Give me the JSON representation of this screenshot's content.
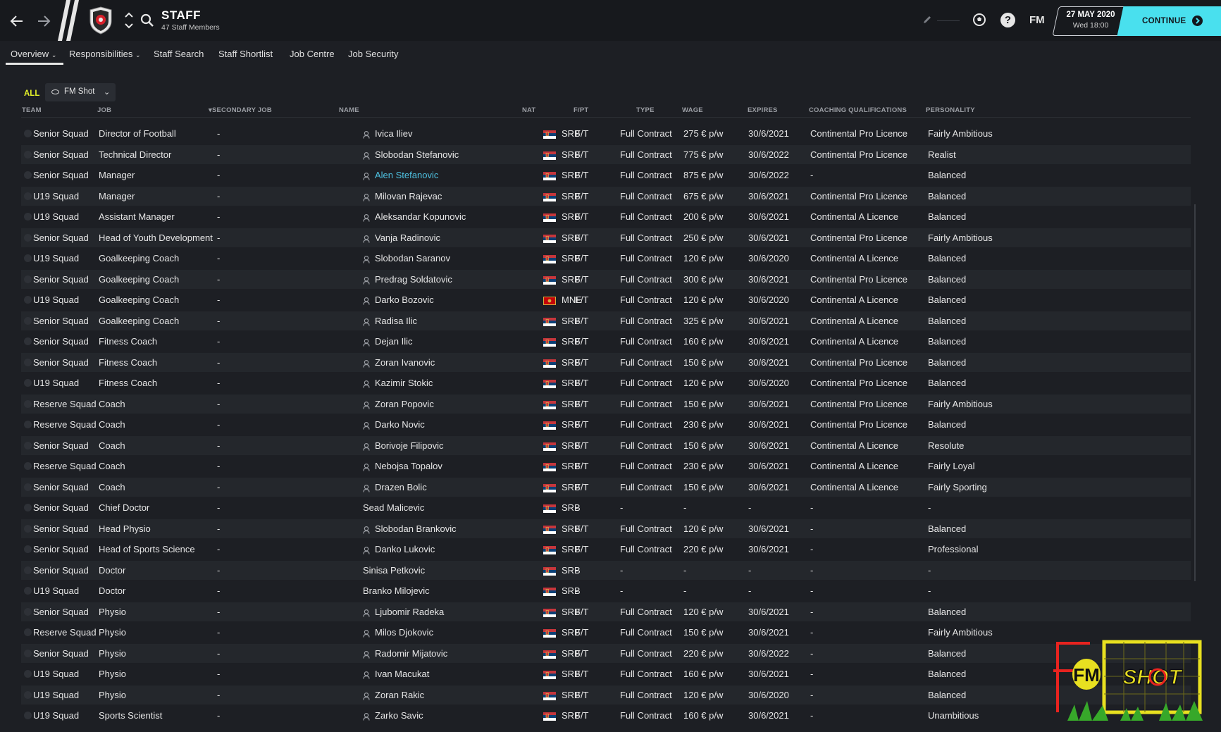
{
  "header": {
    "title": "STAFF",
    "subtitle": "47 Staff Members",
    "date": "27 MAY 2020",
    "time": "Wed 18:00",
    "continue_label": "CONTINUE",
    "fm_label": "FM",
    "help_label": "?"
  },
  "tabs": [
    "Overview",
    "Responsibilities",
    "Staff Search",
    "Staff Shortlist",
    "Job Centre",
    "Job Security"
  ],
  "filter": {
    "all_label": "ALL",
    "view_label": "FM Shot"
  },
  "columns": {
    "team": "TEAM",
    "job": "JOB",
    "secondary": "SECONDARY JOB",
    "name": "NAME",
    "nat": "NAT",
    "fpt": "F/PT",
    "type": "TYPE",
    "wage": "WAGE",
    "expires": "EXPIRES",
    "coaching": "COACHING QUALIFICATIONS",
    "personality": "PERSONALITY"
  },
  "rows": [
    {
      "team": "Senior Squad",
      "job": "Director of Football",
      "secondary": "-",
      "name": "Ivica Iliev",
      "nat": "SRB",
      "fpt": "F/T",
      "type": "Full Contract",
      "wage": "275 € p/w",
      "expires": "30/6/2021",
      "coaching": "Continental Pro Licence",
      "personality": "Fairly Ambitious",
      "person": true
    },
    {
      "team": "Senior Squad",
      "job": "Technical Director",
      "secondary": "-",
      "name": "Slobodan Stefanovic",
      "nat": "SRB",
      "fpt": "F/T",
      "type": "Full Contract",
      "wage": "775 € p/w",
      "expires": "30/6/2022",
      "coaching": "Continental Pro Licence",
      "personality": "Realist",
      "person": true
    },
    {
      "team": "Senior Squad",
      "job": "Manager",
      "secondary": "-",
      "name": "Alen Stefanovic",
      "nat": "SRB",
      "fpt": "F/T",
      "type": "Full Contract",
      "wage": "875 € p/w",
      "expires": "30/6/2022",
      "coaching": "-",
      "personality": "Balanced",
      "person": true,
      "highlight": true
    },
    {
      "team": "U19 Squad",
      "job": "Manager",
      "secondary": "-",
      "name": "Milovan Rajevac",
      "nat": "SRB",
      "fpt": "F/T",
      "type": "Full Contract",
      "wage": "675 € p/w",
      "expires": "30/6/2021",
      "coaching": "Continental Pro Licence",
      "personality": "Balanced",
      "person": true
    },
    {
      "team": "U19 Squad",
      "job": "Assistant Manager",
      "secondary": "-",
      "name": "Aleksandar Kopunovic",
      "nat": "SRB",
      "fpt": "F/T",
      "type": "Full Contract",
      "wage": "200 € p/w",
      "expires": "30/6/2021",
      "coaching": "Continental A Licence",
      "personality": "Balanced",
      "person": true
    },
    {
      "team": "Senior Squad",
      "job": "Head of Youth Development",
      "secondary": "-",
      "name": "Vanja Radinovic",
      "nat": "SRB",
      "fpt": "F/T",
      "type": "Full Contract",
      "wage": "250 € p/w",
      "expires": "30/6/2021",
      "coaching": "Continental Pro Licence",
      "personality": "Fairly Ambitious",
      "person": true
    },
    {
      "team": "U19 Squad",
      "job": "Goalkeeping Coach",
      "secondary": "-",
      "name": "Slobodan Saranov",
      "nat": "SRB",
      "fpt": "F/T",
      "type": "Full Contract",
      "wage": "120 € p/w",
      "expires": "30/6/2020",
      "coaching": "Continental A Licence",
      "personality": "Balanced",
      "person": true
    },
    {
      "team": "Senior Squad",
      "job": "Goalkeeping Coach",
      "secondary": "-",
      "name": "Predrag Soldatovic",
      "nat": "SRB",
      "fpt": "F/T",
      "type": "Full Contract",
      "wage": "300 € p/w",
      "expires": "30/6/2021",
      "coaching": "Continental Pro Licence",
      "personality": "Balanced",
      "person": true
    },
    {
      "team": "U19 Squad",
      "job": "Goalkeeping Coach",
      "secondary": "-",
      "name": "Darko Bozovic",
      "nat": "MNE",
      "fpt": "F/T",
      "type": "Full Contract",
      "wage": "120 € p/w",
      "expires": "30/6/2020",
      "coaching": "Continental A Licence",
      "personality": "Balanced",
      "person": true
    },
    {
      "team": "Senior Squad",
      "job": "Goalkeeping Coach",
      "secondary": "-",
      "name": "Radisa Ilic",
      "nat": "SRB",
      "fpt": "F/T",
      "type": "Full Contract",
      "wage": "325 € p/w",
      "expires": "30/6/2021",
      "coaching": "Continental A Licence",
      "personality": "Balanced",
      "person": true
    },
    {
      "team": "Senior Squad",
      "job": "Fitness Coach",
      "secondary": "-",
      "name": "Dejan Ilic",
      "nat": "SRB",
      "fpt": "F/T",
      "type": "Full Contract",
      "wage": "160 € p/w",
      "expires": "30/6/2021",
      "coaching": "Continental A Licence",
      "personality": "Balanced",
      "person": true
    },
    {
      "team": "Senior Squad",
      "job": "Fitness Coach",
      "secondary": "-",
      "name": "Zoran Ivanovic",
      "nat": "SRB",
      "fpt": "F/T",
      "type": "Full Contract",
      "wage": "150 € p/w",
      "expires": "30/6/2021",
      "coaching": "Continental Pro Licence",
      "personality": "Balanced",
      "person": true
    },
    {
      "team": "U19 Squad",
      "job": "Fitness Coach",
      "secondary": "-",
      "name": "Kazimir Stokic",
      "nat": "SRB",
      "fpt": "F/T",
      "type": "Full Contract",
      "wage": "120 € p/w",
      "expires": "30/6/2020",
      "coaching": "Continental Pro Licence",
      "personality": "Balanced",
      "person": true
    },
    {
      "team": "Reserve Squad",
      "job": "Coach",
      "secondary": "-",
      "name": "Zoran Popovic",
      "nat": "SRB",
      "fpt": "F/T",
      "type": "Full Contract",
      "wage": "150 € p/w",
      "expires": "30/6/2021",
      "coaching": "Continental Pro Licence",
      "personality": "Fairly Ambitious",
      "person": true
    },
    {
      "team": "Reserve Squad",
      "job": "Coach",
      "secondary": "-",
      "name": "Darko Novic",
      "nat": "SRB",
      "fpt": "F/T",
      "type": "Full Contract",
      "wage": "230 € p/w",
      "expires": "30/6/2021",
      "coaching": "Continental Pro Licence",
      "personality": "Balanced",
      "person": true
    },
    {
      "team": "Senior Squad",
      "job": "Coach",
      "secondary": "-",
      "name": "Borivoje Filipovic",
      "nat": "SRB",
      "fpt": "F/T",
      "type": "Full Contract",
      "wage": "150 € p/w",
      "expires": "30/6/2021",
      "coaching": "Continental A Licence",
      "personality": "Resolute",
      "person": true
    },
    {
      "team": "Reserve Squad",
      "job": "Coach",
      "secondary": "-",
      "name": "Nebojsa Topalov",
      "nat": "SRB",
      "fpt": "F/T",
      "type": "Full Contract",
      "wage": "230 € p/w",
      "expires": "30/6/2021",
      "coaching": "Continental A Licence",
      "personality": "Fairly Loyal",
      "person": true
    },
    {
      "team": "Senior Squad",
      "job": "Coach",
      "secondary": "-",
      "name": "Drazen Bolic",
      "nat": "SRB",
      "fpt": "F/T",
      "type": "Full Contract",
      "wage": "150 € p/w",
      "expires": "30/6/2021",
      "coaching": "Continental A Licence",
      "personality": "Fairly Sporting",
      "person": true
    },
    {
      "team": "Senior Squad",
      "job": "Chief Doctor",
      "secondary": "-",
      "name": "Sead Malicevic",
      "nat": "SRB",
      "fpt": "-",
      "type": "-",
      "wage": "-",
      "expires": "-",
      "coaching": "-",
      "personality": "-",
      "person": false
    },
    {
      "team": "Senior Squad",
      "job": "Head Physio",
      "secondary": "-",
      "name": "Slobodan Brankovic",
      "nat": "SRB",
      "fpt": "F/T",
      "type": "Full Contract",
      "wage": "120 € p/w",
      "expires": "30/6/2021",
      "coaching": "-",
      "personality": "Balanced",
      "person": true
    },
    {
      "team": "Senior Squad",
      "job": "Head of Sports Science",
      "secondary": "-",
      "name": "Danko Lukovic",
      "nat": "SRB",
      "fpt": "F/T",
      "type": "Full Contract",
      "wage": "220 € p/w",
      "expires": "30/6/2021",
      "coaching": "-",
      "personality": "Professional",
      "person": true
    },
    {
      "team": "Senior Squad",
      "job": "Doctor",
      "secondary": "-",
      "name": "Sinisa Petkovic",
      "nat": "SRB",
      "fpt": "-",
      "type": "-",
      "wage": "-",
      "expires": "-",
      "coaching": "-",
      "personality": "-",
      "person": false
    },
    {
      "team": "U19 Squad",
      "job": "Doctor",
      "secondary": "-",
      "name": "Branko Milojevic",
      "nat": "SRB",
      "fpt": "-",
      "type": "-",
      "wage": "-",
      "expires": "-",
      "coaching": "-",
      "personality": "-",
      "person": false
    },
    {
      "team": "Senior Squad",
      "job": "Physio",
      "secondary": "-",
      "name": "Ljubomir Radeka",
      "nat": "SRB",
      "fpt": "F/T",
      "type": "Full Contract",
      "wage": "120 € p/w",
      "expires": "30/6/2021",
      "coaching": "-",
      "personality": "Balanced",
      "person": true
    },
    {
      "team": "Reserve Squad",
      "job": "Physio",
      "secondary": "-",
      "name": "Milos Djokovic",
      "nat": "SRB",
      "fpt": "F/T",
      "type": "Full Contract",
      "wage": "150 € p/w",
      "expires": "30/6/2021",
      "coaching": "-",
      "personality": "Fairly Ambitious",
      "person": true
    },
    {
      "team": "Senior Squad",
      "job": "Physio",
      "secondary": "-",
      "name": "Radomir Mijatovic",
      "nat": "SRB",
      "fpt": "F/T",
      "type": "Full Contract",
      "wage": "220 € p/w",
      "expires": "30/6/2022",
      "coaching": "-",
      "personality": "Balanced",
      "person": true
    },
    {
      "team": "U19 Squad",
      "job": "Physio",
      "secondary": "-",
      "name": "Ivan Macukat",
      "nat": "SRB",
      "fpt": "F/T",
      "type": "Full Contract",
      "wage": "160 € p/w",
      "expires": "30/6/2021",
      "coaching": "-",
      "personality": "Balanced",
      "person": true
    },
    {
      "team": "U19 Squad",
      "job": "Physio",
      "secondary": "-",
      "name": "Zoran Rakic",
      "nat": "SRB",
      "fpt": "F/T",
      "type": "Full Contract",
      "wage": "120 € p/w",
      "expires": "30/6/2020",
      "coaching": "-",
      "personality": "Balanced",
      "person": true
    },
    {
      "team": "U19 Squad",
      "job": "Sports Scientist",
      "secondary": "-",
      "name": "Zarko Savic",
      "nat": "SRB",
      "fpt": "F/T",
      "type": "Full Contract",
      "wage": "160 € p/w",
      "expires": "30/6/2021",
      "coaching": "-",
      "personality": "Unambitious",
      "person": true
    }
  ],
  "watermark": {
    "fm": "FM",
    "shot": "SHOT"
  },
  "colors": {
    "accent": "#49e0ee",
    "all_filter": "#e3f029",
    "link": "#4fc3e3",
    "background": "#1d1f24"
  },
  "icons": [
    "back-arrow-icon",
    "forward-arrow-icon",
    "club-crest-icon",
    "up-down-icon",
    "search-icon",
    "pencil-icon",
    "football-icon",
    "help-icon",
    "eye-icon",
    "person-icon",
    "serbia-flag-icon",
    "montenegro-flag-icon"
  ]
}
